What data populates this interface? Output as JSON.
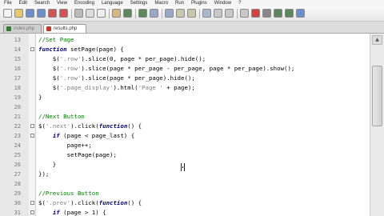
{
  "menu": [
    "File",
    "Edit",
    "Search",
    "View",
    "Encoding",
    "Language",
    "Settings",
    "Macro",
    "Run",
    "Plugins",
    "Window",
    "?"
  ],
  "tabs": [
    {
      "label": "index.php",
      "active": false,
      "icon_color": "#2f7d2f"
    },
    {
      "label": "results.php",
      "active": true,
      "icon_color": "#c0392b"
    }
  ],
  "colors": {
    "comment": "#008000",
    "keyword": "#00008b",
    "string": "#808080",
    "operator": "#000080"
  },
  "editor": {
    "lines": [
      {
        "num": "13",
        "fold": false,
        "tokens": [
          {
            "t": "//Set Page",
            "c": "cm"
          }
        ]
      },
      {
        "num": "14",
        "fold": true,
        "tokens": [
          {
            "t": "function",
            "c": "kw"
          },
          {
            "t": " setPage(page) {",
            "c": "df"
          }
        ]
      },
      {
        "num": "15",
        "fold": false,
        "tokens": [
          {
            "t": "    $(",
            "c": "df"
          },
          {
            "t": "'.row'",
            "c": "str"
          },
          {
            "t": ").slice(0, page * per_page).hide();",
            "c": "df"
          }
        ]
      },
      {
        "num": "16",
        "fold": false,
        "tokens": [
          {
            "t": "    $(",
            "c": "df"
          },
          {
            "t": "'.row'",
            "c": "str"
          },
          {
            "t": ").slice(page * per_page - per_page, page * per_page).show();",
            "c": "df"
          }
        ]
      },
      {
        "num": "17",
        "fold": false,
        "tokens": [
          {
            "t": "    $(",
            "c": "df"
          },
          {
            "t": "'.row'",
            "c": "str"
          },
          {
            "t": ").slice(page * per_page).hide();",
            "c": "df"
          }
        ]
      },
      {
        "num": "18",
        "fold": false,
        "tokens": [
          {
            "t": "    $(",
            "c": "df"
          },
          {
            "t": "'.page_display'",
            "c": "str"
          },
          {
            "t": ").html(",
            "c": "df"
          },
          {
            "t": "'Page '",
            "c": "str"
          },
          {
            "t": " + page);",
            "c": "df"
          }
        ]
      },
      {
        "num": "19",
        "fold": false,
        "tokens": [
          {
            "t": "}",
            "c": "df"
          }
        ]
      },
      {
        "num": "20",
        "fold": false,
        "tokens": []
      },
      {
        "num": "21",
        "fold": false,
        "tokens": [
          {
            "t": "//Next Button",
            "c": "cm"
          }
        ]
      },
      {
        "num": "22",
        "fold": true,
        "tokens": [
          {
            "t": "$(",
            "c": "df"
          },
          {
            "t": "'.next'",
            "c": "str"
          },
          {
            "t": ").click(",
            "c": "df"
          },
          {
            "t": "function",
            "c": "kw"
          },
          {
            "t": "() {",
            "c": "df"
          }
        ]
      },
      {
        "num": "23",
        "fold": true,
        "tokens": [
          {
            "t": "    ",
            "c": "df"
          },
          {
            "t": "if",
            "c": "kw"
          },
          {
            "t": " (page < page_last) {",
            "c": "df"
          }
        ]
      },
      {
        "num": "24",
        "fold": false,
        "tokens": [
          {
            "t": "        page++;",
            "c": "df"
          }
        ]
      },
      {
        "num": "25",
        "fold": false,
        "tokens": [
          {
            "t": "        setPage(page);",
            "c": "df"
          }
        ]
      },
      {
        "num": "26",
        "fold": false,
        "tokens": [
          {
            "t": "    }",
            "c": "df"
          }
        ]
      },
      {
        "num": "27",
        "fold": false,
        "tokens": [
          {
            "t": "});",
            "c": "df"
          }
        ]
      },
      {
        "num": "28",
        "fold": false,
        "tokens": []
      },
      {
        "num": "29",
        "fold": false,
        "tokens": [
          {
            "t": "//Previous Button",
            "c": "cm"
          }
        ]
      },
      {
        "num": "30",
        "fold": true,
        "tokens": [
          {
            "t": "$(",
            "c": "df"
          },
          {
            "t": "'.prev'",
            "c": "str"
          },
          {
            "t": ").click(",
            "c": "df"
          },
          {
            "t": "function",
            "c": "kw"
          },
          {
            "t": "() {",
            "c": "df"
          }
        ]
      },
      {
        "num": "31",
        "fold": true,
        "tokens": [
          {
            "t": "    ",
            "c": "df"
          },
          {
            "t": "if",
            "c": "kw"
          },
          {
            "t": " (page > 1) {",
            "c": "df"
          }
        ]
      }
    ]
  },
  "toolbar_buttons": [
    {
      "name": "new-file-icon",
      "color": "#f4f4f4"
    },
    {
      "name": "open-file-icon",
      "color": "#e8c868"
    },
    {
      "name": "save-icon",
      "color": "#6a8fd0"
    },
    {
      "name": "save-all-icon",
      "color": "#6a8fd0"
    },
    {
      "name": "close-icon",
      "color": "#d85050"
    },
    {
      "name": "close-all-icon",
      "color": "#d85050"
    },
    {
      "name": "print-icon",
      "color": "#bbbbbb"
    },
    {
      "name": "cut-icon",
      "color": "#dddddd"
    },
    {
      "name": "copy-icon",
      "color": "#eeeeee"
    },
    {
      "name": "paste-icon",
      "color": "#d8b878"
    },
    {
      "name": "undo-icon",
      "color": "#5a8a5a"
    },
    {
      "name": "redo-icon",
      "color": "#5a8a5a"
    },
    {
      "name": "find-icon",
      "color": "#9aa8c8"
    },
    {
      "name": "replace-icon",
      "color": "#9aa8c8"
    },
    {
      "name": "zoom-in-icon",
      "color": "#c8c8a8"
    },
    {
      "name": "zoom-out-icon",
      "color": "#c8c8a8"
    },
    {
      "name": "sync-scroll-icon",
      "color": "#a8b8c8"
    },
    {
      "name": "word-wrap-icon",
      "color": "#c8c8c8"
    },
    {
      "name": "show-all-chars-icon",
      "color": "#c8c8c8"
    },
    {
      "name": "indent-guide-icon",
      "color": "#c8c8c8"
    },
    {
      "name": "record-macro-icon",
      "color": "#d84040"
    },
    {
      "name": "stop-macro-icon",
      "color": "#888888"
    },
    {
      "name": "play-macro-icon",
      "color": "#5a8a5a"
    },
    {
      "name": "run-macro-multiple-icon",
      "color": "#5a8a5a"
    },
    {
      "name": "save-macro-icon",
      "color": "#6a8fd0"
    }
  ]
}
